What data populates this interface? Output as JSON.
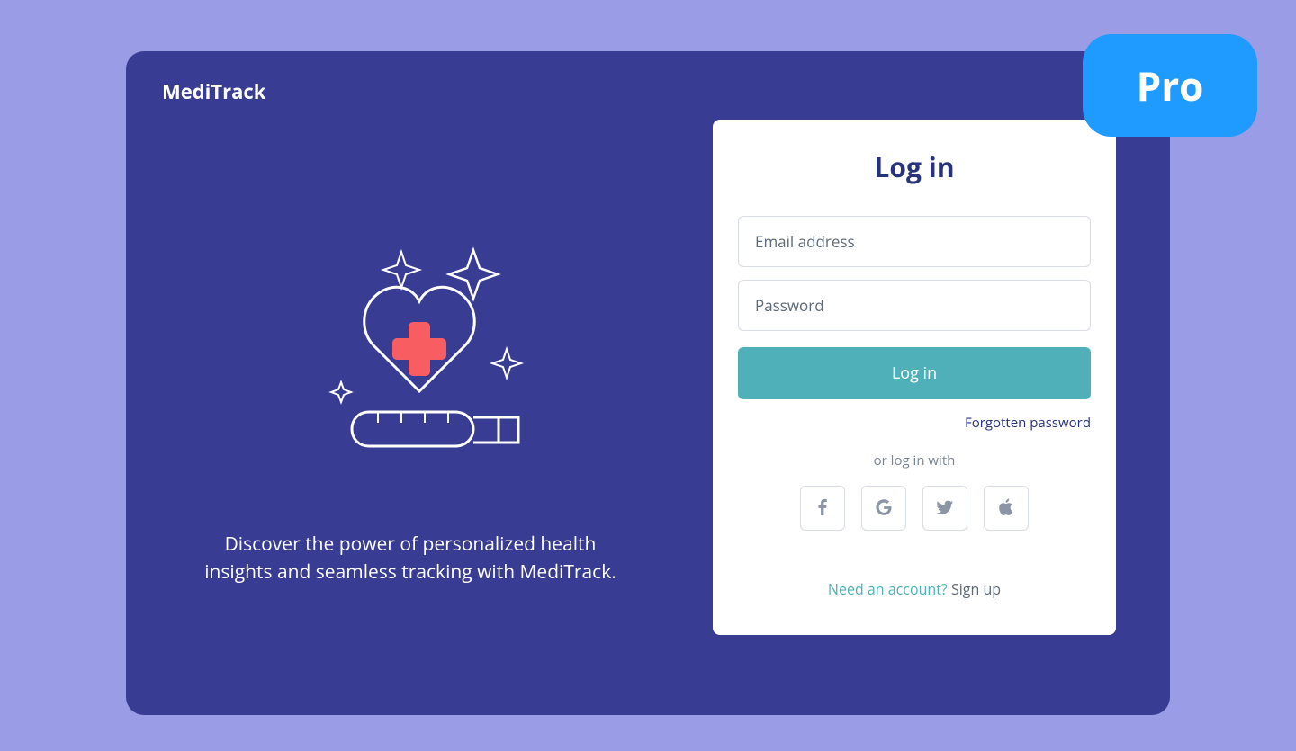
{
  "brand": "MediTrack",
  "badge": "Pro",
  "tagline": "Discover the power of personalized health insights and seamless tracking with MediTrack.",
  "login": {
    "title": "Log in",
    "email_placeholder": "Email address",
    "password_placeholder": "Password",
    "button": "Log in",
    "forgot": "Forgotten password",
    "divider": "or log in with",
    "signup_prompt": "Need an account? ",
    "signup_link": "Sign up"
  },
  "social": {
    "facebook": "facebook",
    "google": "google",
    "twitter": "twitter",
    "apple": "apple"
  },
  "colors": {
    "page_bg": "#9a9ce5",
    "card_bg": "#383c92",
    "badge_bg": "#1f9bff",
    "accent_teal": "#4fb0b9",
    "title_navy": "#283379",
    "plus_red": "#f85d62"
  }
}
